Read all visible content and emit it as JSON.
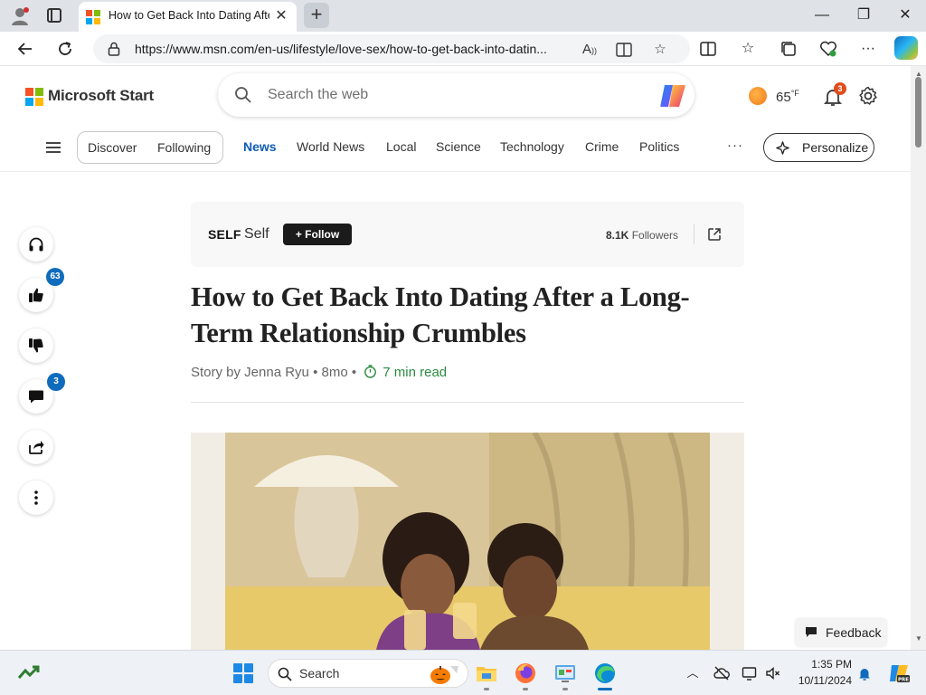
{
  "browser": {
    "tab_title": "How to Get Back Into Dating After a Long-Term Relationship Crumbles",
    "tab_close": "✕",
    "new_tab": "+",
    "url": "https://www.msn.com/en-us/lifestyle/love-sex/how-to-get-back-into-datin...",
    "window": {
      "minimize": "—",
      "maximize": "❐",
      "close": "✕"
    }
  },
  "site": {
    "brand": "Microsoft Start",
    "search_placeholder": "Search the web",
    "weather_temp": "65",
    "weather_unit": "°F",
    "notification_count": "3"
  },
  "nav": {
    "pill_items": [
      "Discover",
      "Following"
    ],
    "items": [
      "News",
      "World News",
      "Local",
      "Science",
      "Technology",
      "Crime",
      "Politics"
    ],
    "active": "News",
    "more": "···",
    "personalize": "Personalize"
  },
  "rail": {
    "like_count": "63",
    "comment_count": "3"
  },
  "publisher": {
    "logo": "SELF",
    "name": "Self",
    "follow_label": "+ Follow",
    "followers_count": "8.1K",
    "followers_label": "Followers"
  },
  "article": {
    "headline": "How to Get Back Into Dating After a Long-Term Relationship Crumbles",
    "byline": "Story by Jenna Ryu • 8mo •",
    "read_time": "7 min read"
  },
  "feedback_label": "Feedback",
  "taskbar": {
    "search_label": "Search",
    "time": "1:35 PM",
    "date": "10/11/2024"
  },
  "colors": {
    "accent_blue": "#0f5cb5",
    "badge_blue": "#0f6cbd",
    "read_green": "#2b8a3e",
    "notification_orange": "#e04d1c"
  }
}
